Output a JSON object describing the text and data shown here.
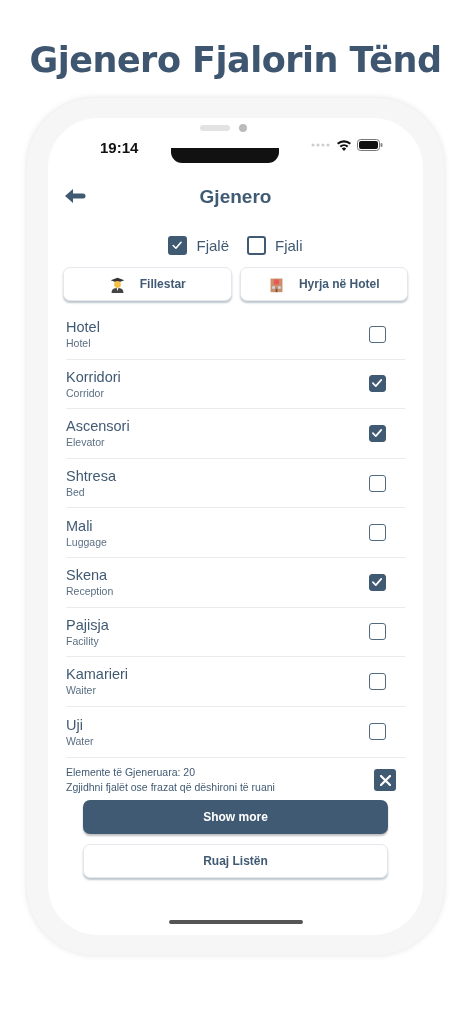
{
  "headline": "Gjenero Fjalorin Tënd",
  "status_bar": {
    "time": "19:14"
  },
  "nav": {
    "title": "Gjenero"
  },
  "filters": [
    {
      "label": "Fjalë",
      "checked": true
    },
    {
      "label": "Fjali",
      "checked": false
    }
  ],
  "categories": [
    {
      "label": "Fillestar",
      "kind": "student"
    },
    {
      "label": "Hyrja në Hotel",
      "kind": "hotel"
    }
  ],
  "words": [
    {
      "word": "Hotel",
      "translation": "Hotel",
      "checked": false
    },
    {
      "word": "Korridori",
      "translation": "Corridor",
      "checked": true
    },
    {
      "word": "Ascensori",
      "translation": "Elevator",
      "checked": true
    },
    {
      "word": "Shtresa",
      "translation": "Bed",
      "checked": false
    },
    {
      "word": "Mali",
      "translation": "Luggage",
      "checked": false
    },
    {
      "word": "Skena",
      "translation": "Reception",
      "checked": true
    },
    {
      "word": "Pajisja",
      "translation": "Facility",
      "checked": false
    },
    {
      "word": "Kamarieri",
      "translation": "Waiter",
      "checked": false
    },
    {
      "word": "Uji",
      "translation": "Water",
      "checked": false
    }
  ],
  "footer": {
    "count": "Elemente të Gjeneruara: 20",
    "hint": "Zgjidhni fjalët ose frazat që dëshironi të ruani"
  },
  "buttons": [
    {
      "label": "Show more",
      "kind": "primary"
    },
    {
      "label": "Ruaj Listën",
      "kind": "secondary"
    }
  ]
}
